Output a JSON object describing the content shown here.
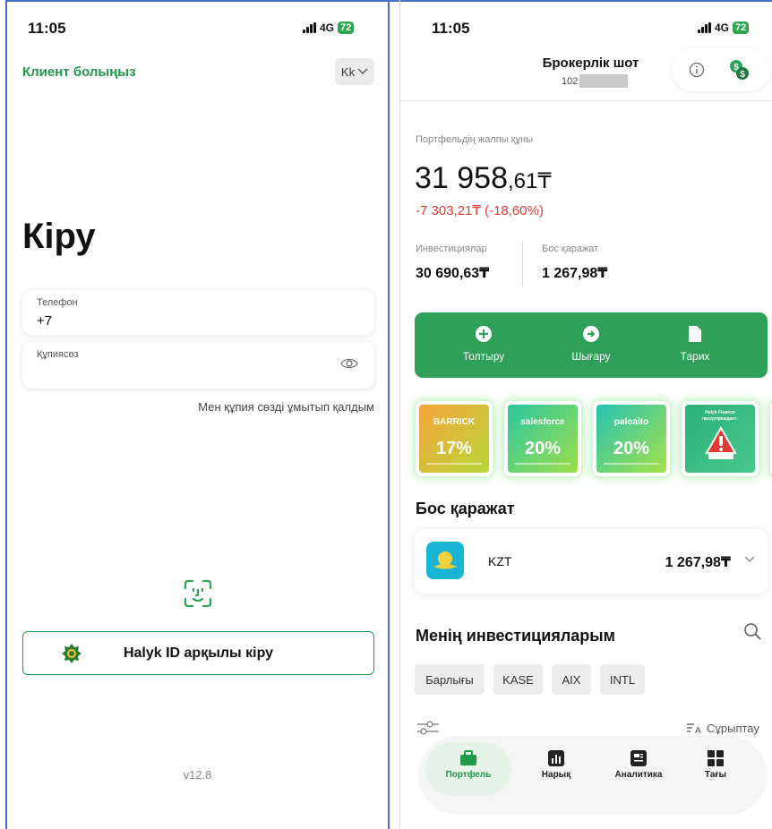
{
  "left": {
    "status": {
      "time": "11:05",
      "network": "4G",
      "battery": "72"
    },
    "client_label": "Клиент болыңыз",
    "language": "Kk",
    "title": "Кіру",
    "phone_field": {
      "label": "Телефон",
      "value": "+7"
    },
    "password_field": {
      "label": "Құпиясөз",
      "value": ""
    },
    "forgot_password": "Мен құпия сөзді ұмытып қалдым",
    "halyk_id_button": "Halyk ID арқылы кіру",
    "version": "v12.8"
  },
  "right": {
    "status": {
      "time": "11:05",
      "network": "4G",
      "battery": "72"
    },
    "account_title": "Брокерлік шот",
    "account_number_prefix": "102",
    "portfolio_label": "Портфельдің жалпы құны",
    "portfolio_value_main": "31 958",
    "portfolio_value_fraction": ",61₸",
    "portfolio_change": "-7 303,21₸ (-18,60%)",
    "investments_label": "Инвестициялар",
    "investments_value": "30 690,63₸",
    "free_cash_label": "Бос қаражат",
    "free_cash_value": "1 267,98₸",
    "actions": [
      {
        "label": "Толтыру",
        "icon": "plus-circle-icon"
      },
      {
        "label": "Шығару",
        "icon": "arrow-right-circle-icon"
      },
      {
        "label": "Тарих",
        "icon": "document-icon"
      }
    ],
    "promos": [
      {
        "brand": "BARRICK",
        "percent": "17%",
        "color_a": "#f7a53a",
        "color_b": "#b8d63a"
      },
      {
        "brand": "salesforce",
        "percent": "20%",
        "color_a": "#2cc6a0",
        "color_b": "#9ddf4a"
      },
      {
        "brand": "paloalto",
        "percent": "20%",
        "color_a": "#27c2b0",
        "color_b": "#a6e24b"
      },
      {
        "brand": "Halyk Finance предупреждает:",
        "percent": "",
        "color_a": "#2bb07a",
        "color_b": "#49c98a"
      }
    ],
    "cash_section_title": "Бос қаражат",
    "cash_currency": "KZT",
    "cash_amount": "1 267,98₸",
    "investments_section_title": "Менің инвестицияларым",
    "filter_chips": [
      "Барлығы",
      "KASE",
      "AIX",
      "INTL"
    ],
    "sort_label": "Сұрыптау",
    "tabs": [
      {
        "label": "Портфель",
        "icon": "briefcase-icon",
        "active": true
      },
      {
        "label": "Нарық",
        "icon": "chart-icon",
        "active": false
      },
      {
        "label": "Аналитика",
        "icon": "news-icon",
        "active": false
      },
      {
        "label": "Тағы",
        "icon": "grid-icon",
        "active": false
      }
    ]
  },
  "colors": {
    "accent": "#1f9a4a",
    "action_bar": "#2ea05a",
    "negative": "#e53935"
  }
}
